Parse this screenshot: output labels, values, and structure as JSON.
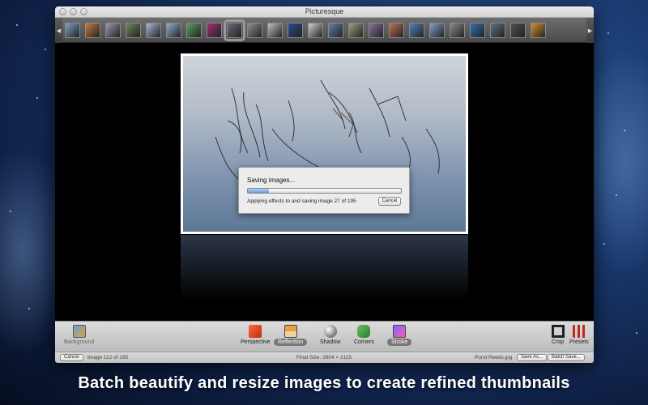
{
  "window": {
    "title": "Picturesque"
  },
  "filmstrip": {
    "thumbs": [
      "#7aa0c8",
      "#c87a3a",
      "#9a9ab0",
      "#6a8a5a",
      "#a8b8d8",
      "#8ab0d0",
      "#5aa05a",
      "#a03070",
      "#6a6a7a",
      "#909090",
      "#c0c0c0",
      "#2a4a8a",
      "#d0d0d0",
      "#6080a8",
      "#a0a080",
      "#8a70a0",
      "#c07050",
      "#5080c0",
      "#80a0c8",
      "#8a8a8a",
      "#3070b0",
      "#607080",
      "#505050",
      "#d09030"
    ],
    "selected_index": 8
  },
  "dialog": {
    "title": "Saving images...",
    "message": "Applying effects to and saving image 27 of 195",
    "cancel_label": "Cancel",
    "progress": 0.14
  },
  "toolbar": {
    "background": "Background",
    "perspective": "Perspective",
    "reflection": "Reflection",
    "shadow": "Shadow",
    "corners": "Corners",
    "stroke": "Stroke",
    "crop": "Crop",
    "presets": "Presets"
  },
  "status": {
    "cancel_label": "Cancel",
    "image_counter": "Image 112 of 195",
    "final_size": "Final Size: 2604 × 2115",
    "filename": "Pond Reeds.jpg",
    "save_as_label": "Save As...",
    "batch_save_label": "Batch Save..."
  },
  "caption": "Batch beautify and resize images to create refined thumbnails"
}
